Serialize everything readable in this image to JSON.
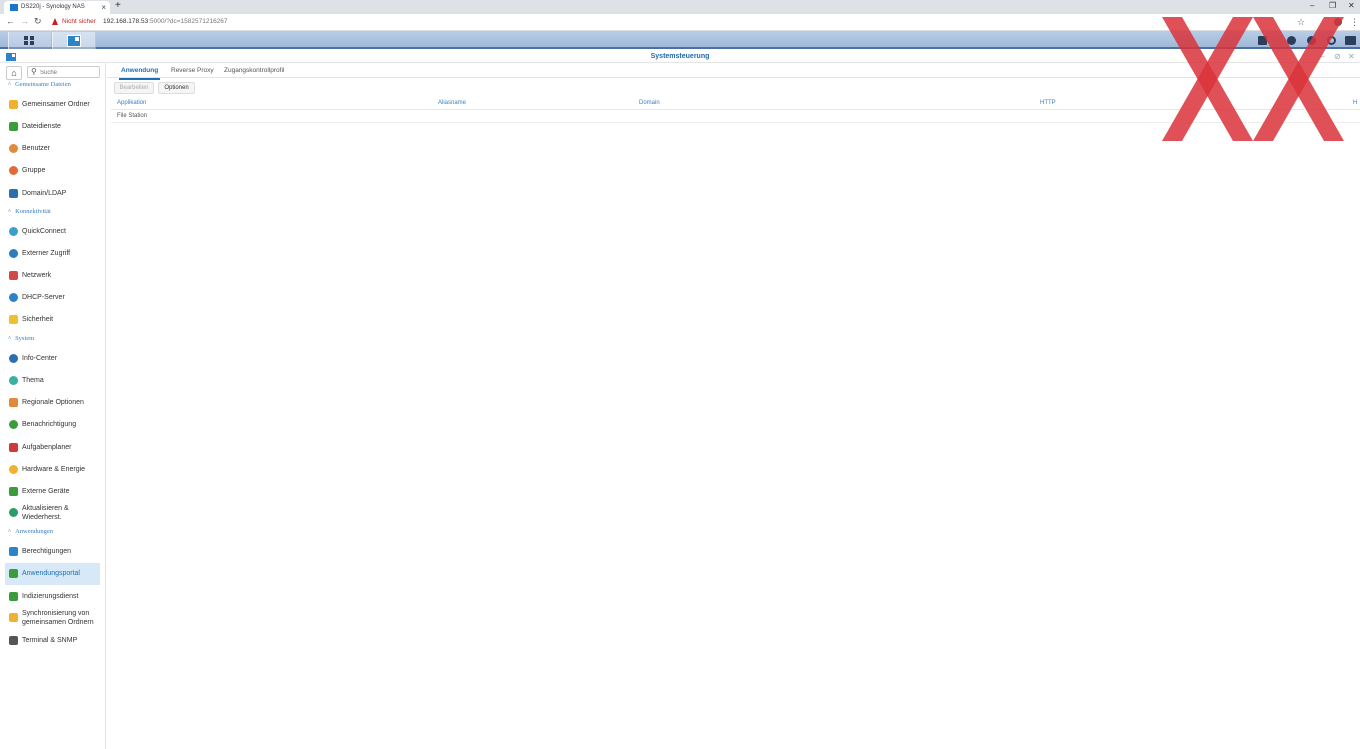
{
  "browser": {
    "tab_title": "DS220j - Synology NAS",
    "tab_close": "×",
    "new_tab": "+",
    "not_secure": "Nicht sicher",
    "url_host": "192.168.178.53",
    "url_rest": ":5000/?dc=1582571216267",
    "win_minimize": "–",
    "win_restore": "❐",
    "win_close": "✕"
  },
  "window": {
    "title": "Systemsteuerung"
  },
  "sidebar": {
    "search_placeholder": "Suche",
    "sections": [
      {
        "label": "Gemeinsame Dateien"
      },
      {
        "label": "Konnektivität"
      },
      {
        "label": "System"
      },
      {
        "label": "Anwendungen"
      }
    ],
    "items": [
      {
        "label": "Gemeinsamer Ordner",
        "icon": "shared-folder-icon",
        "color": "#f0b030"
      },
      {
        "label": "Dateidienste",
        "icon": "file-services-icon",
        "color": "#3a9c3a"
      },
      {
        "label": "Benutzer",
        "icon": "user-icon",
        "color": "#e08a3a"
      },
      {
        "label": "Gruppe",
        "icon": "group-icon",
        "color": "#e06a3a"
      },
      {
        "label": "Domain/LDAP",
        "icon": "domain-ldap-icon",
        "color": "#2c6fb0"
      },
      {
        "label": "QuickConnect",
        "icon": "quickconnect-icon",
        "color": "#3aa0c8"
      },
      {
        "label": "Externer Zugriff",
        "icon": "external-access-icon",
        "color": "#2c7cc0"
      },
      {
        "label": "Netzwerk",
        "icon": "network-icon",
        "color": "#d04a4a"
      },
      {
        "label": "DHCP-Server",
        "icon": "dhcp-server-icon",
        "color": "#2c84c8"
      },
      {
        "label": "Sicherheit",
        "icon": "security-icon",
        "color": "#f0c030"
      },
      {
        "label": "Info-Center",
        "icon": "info-center-icon",
        "color": "#2c6fb0"
      },
      {
        "label": "Thema",
        "icon": "theme-icon",
        "color": "#3ab0a0"
      },
      {
        "label": "Regionale Optionen",
        "icon": "regional-options-icon",
        "color": "#e08a3a"
      },
      {
        "label": "Benachrichtigung",
        "icon": "notification-icon",
        "color": "#3a9c3a"
      },
      {
        "label": "Aufgabenplaner",
        "icon": "task-scheduler-icon",
        "color": "#d03a3a"
      },
      {
        "label": "Hardware & Energie",
        "icon": "hardware-power-icon",
        "color": "#f0b030"
      },
      {
        "label": "Externe Geräte",
        "icon": "external-devices-icon",
        "color": "#3a9c3a"
      },
      {
        "label": "Aktualisieren & Wiederherst.",
        "icon": "update-restore-icon",
        "color": "#2c9c6a"
      },
      {
        "label": "Berechtigungen",
        "icon": "privileges-icon",
        "color": "#2c84c8"
      },
      {
        "label": "Anwendungsportal",
        "icon": "application-portal-icon",
        "color": "#3a9c3a"
      },
      {
        "label": "Indizierungsdienst",
        "icon": "indexing-service-icon",
        "color": "#3a9c3a"
      },
      {
        "label": "Synchronisierung von gemeinsamen Ordnern",
        "icon": "shared-folder-sync-icon",
        "color": "#f0b030"
      },
      {
        "label": "Terminal & SNMP",
        "icon": "terminal-snmp-icon",
        "color": "#555555"
      }
    ]
  },
  "main": {
    "tabs": [
      {
        "label": "Anwendung"
      },
      {
        "label": "Reverse Proxy"
      },
      {
        "label": "Zugangskontrollprofil"
      }
    ],
    "buttons": {
      "edit": "Bearbeiten",
      "options": "Optionen"
    },
    "columns": [
      "Applikation",
      "Aliasname",
      "Domain",
      "HTTP",
      "H"
    ],
    "rows": [
      {
        "application": "File Station",
        "alias": "",
        "domain": "",
        "http": ""
      }
    ]
  },
  "colors": {
    "accent": "#1c6fb5",
    "watermark": "#d9323a"
  }
}
